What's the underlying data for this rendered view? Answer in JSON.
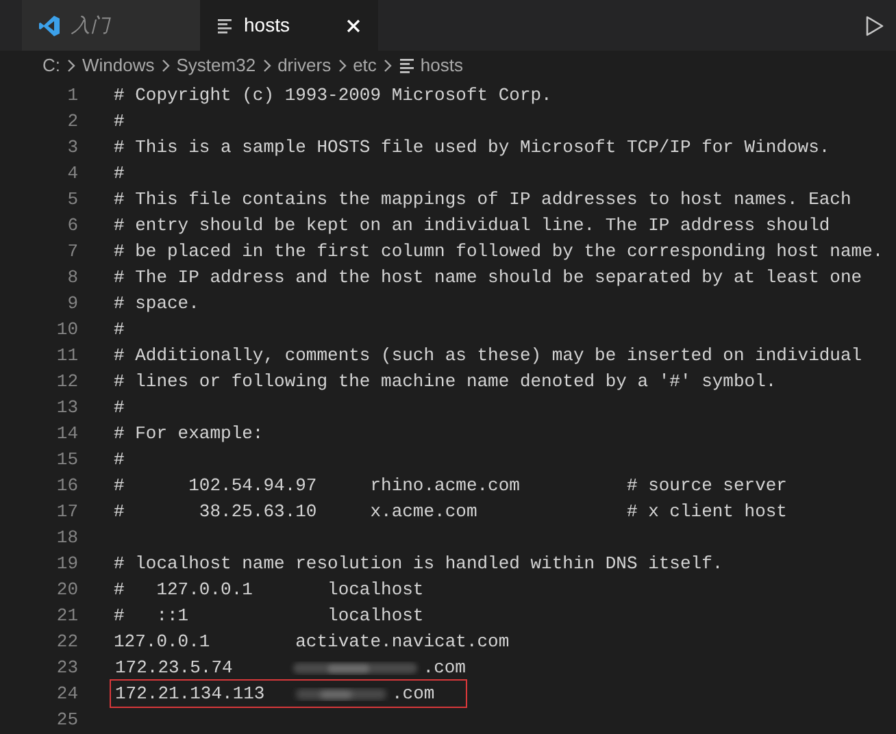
{
  "tabs": [
    {
      "label": "入门",
      "kind": "welcome",
      "selected": false
    },
    {
      "label": "hosts",
      "kind": "file",
      "selected": true
    }
  ],
  "breadcrumb": [
    "C:",
    "Windows",
    "System32",
    "drivers",
    "etc",
    "hosts"
  ],
  "lines": [
    {
      "number": "1",
      "kind": "text",
      "text": "# Copyright (c) 1993-2009 Microsoft Corp."
    },
    {
      "number": "2",
      "kind": "text",
      "text": "#"
    },
    {
      "number": "3",
      "kind": "text",
      "text": "# This is a sample HOSTS file used by Microsoft TCP/IP for Windows."
    },
    {
      "number": "4",
      "kind": "text",
      "text": "#"
    },
    {
      "number": "5",
      "kind": "text",
      "text": "# This file contains the mappings of IP addresses to host names. Each"
    },
    {
      "number": "6",
      "kind": "text",
      "text": "# entry should be kept on an individual line. The IP address should"
    },
    {
      "number": "7",
      "kind": "text",
      "text": "# be placed in the first column followed by the corresponding host name."
    },
    {
      "number": "8",
      "kind": "text",
      "text": "# The IP address and the host name should be separated by at least one"
    },
    {
      "number": "9",
      "kind": "text",
      "text": "# space."
    },
    {
      "number": "10",
      "kind": "text",
      "text": "#"
    },
    {
      "number": "11",
      "kind": "text",
      "text": "# Additionally, comments (such as these) may be inserted on individual"
    },
    {
      "number": "12",
      "kind": "text",
      "text": "# lines or following the machine name denoted by a '#' symbol."
    },
    {
      "number": "13",
      "kind": "text",
      "text": "#"
    },
    {
      "number": "14",
      "kind": "text",
      "text": "# For example:"
    },
    {
      "number": "15",
      "kind": "text",
      "text": "#"
    },
    {
      "number": "16",
      "kind": "text",
      "text": "#      102.54.94.97     rhino.acme.com          # source server"
    },
    {
      "number": "17",
      "kind": "text",
      "text": "#       38.25.63.10     x.acme.com              # x client host"
    },
    {
      "number": "18",
      "kind": "text"
    },
    {
      "number": "19",
      "kind": "text",
      "text": "# localhost name resolution is handled within DNS itself."
    },
    {
      "number": "20",
      "kind": "text",
      "text": "#   127.0.0.1       localhost"
    },
    {
      "number": "21",
      "kind": "text",
      "text": "#   ::1             localhost"
    },
    {
      "number": "22",
      "kind": "text",
      "text": "127.0.0.1        activate.navicat.com"
    },
    {
      "number": "23",
      "kind": "redacted",
      "prefix": "172.23.5.74",
      "suffix": ".com",
      "highlighted": false
    },
    {
      "number": "24",
      "kind": "redacted",
      "prefix": "172.21.134.113",
      "suffix": ".com",
      "highlighted": true
    },
    {
      "number": "25",
      "kind": "text"
    }
  ]
}
